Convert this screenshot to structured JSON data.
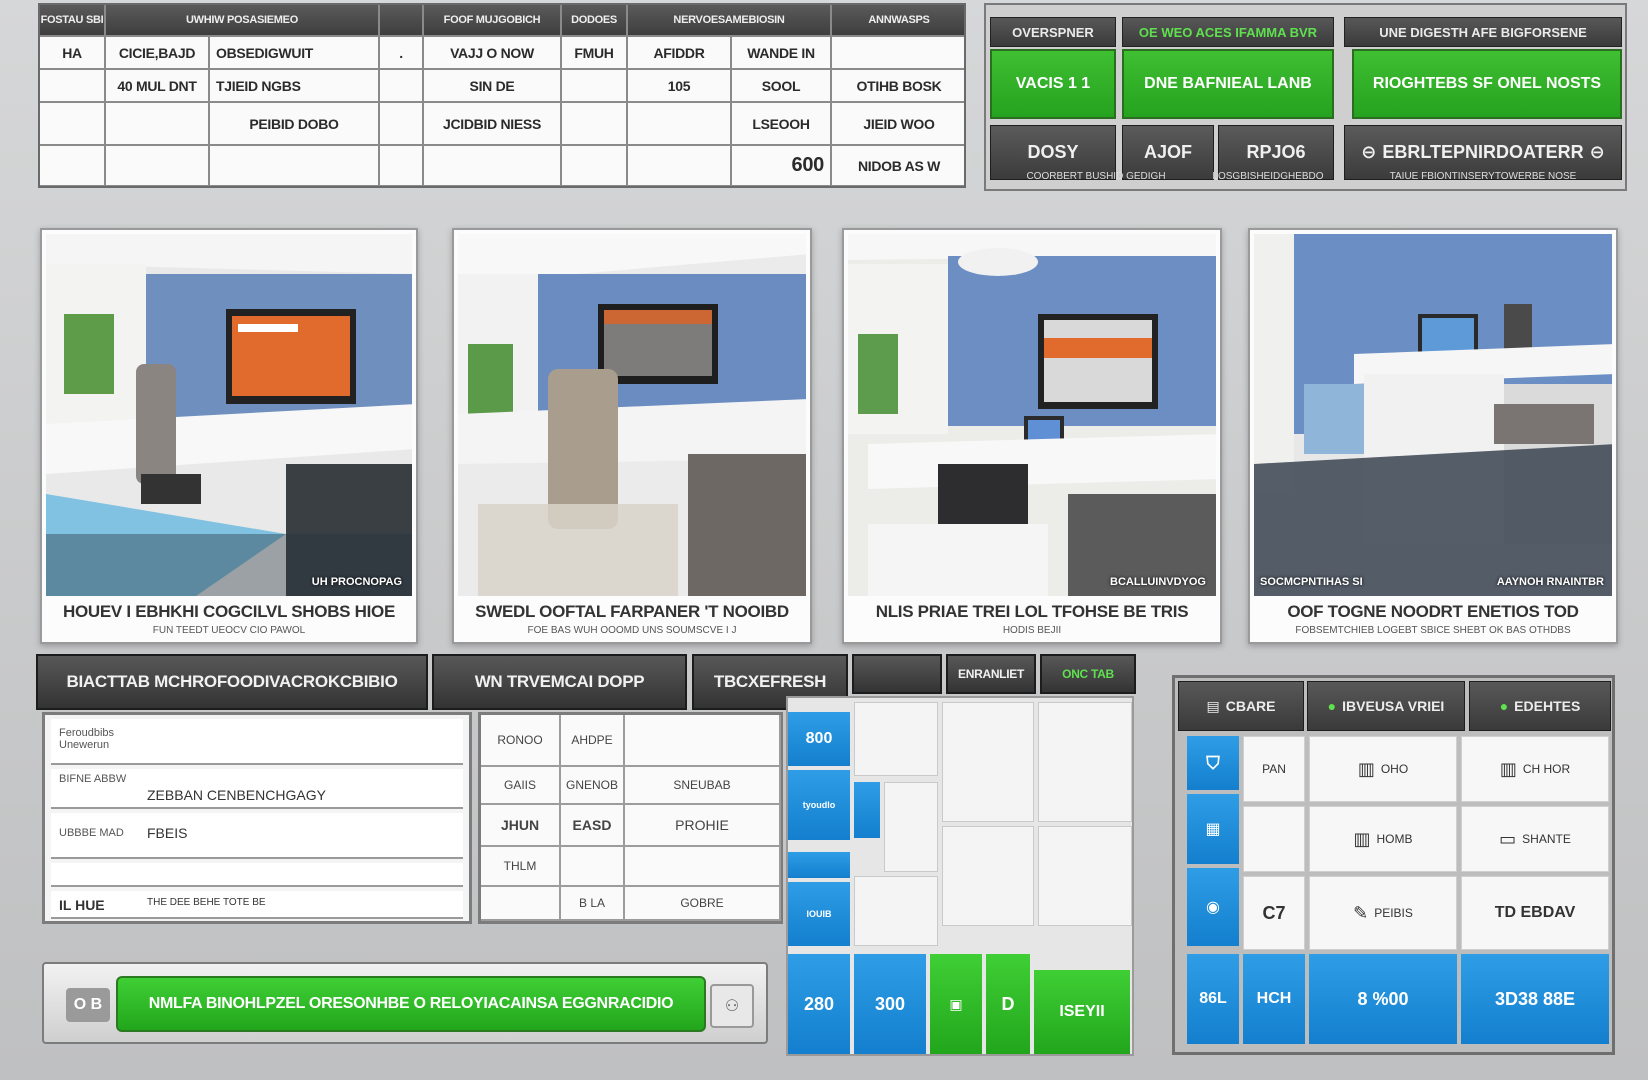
{
  "colors": {
    "accent_green": "#2db526",
    "accent_blue": "#1a8ad8",
    "header_dark": "#3e3e3e"
  },
  "top_table": {
    "headers": [
      "FOSTAU SBI",
      "UWHIW POSASIEMEO",
      "",
      "FOOF MUJGOBICH",
      "DODOES",
      "NERVOESAMEBIOSIN",
      "",
      "ANNWASPS"
    ],
    "rows": [
      [
        "HA",
        "CICIE,BAJD",
        "OBSEDIGWUIT",
        ".",
        "VAJJ O NOW",
        "FMUH",
        "AFIDDR",
        "WANDE IN",
        ""
      ],
      [
        "",
        "40 MUL DNT",
        "TJIEID NGBS",
        "",
        "SIN DE",
        "",
        "105",
        "SOOL",
        "OTIHB BOSK"
      ],
      [
        "",
        "",
        "PEIBID DOBO",
        "",
        "JCIDBID NIESS",
        "",
        "",
        "LSEOOH",
        "JIEID WOO"
      ],
      [
        "",
        "",
        "",
        "",
        "",
        "",
        "",
        "600",
        "NIDOB AS W"
      ]
    ]
  },
  "top_panel": {
    "headers": [
      "OVERSPNER",
      "OE WEO ACES IFAMMA BVR",
      "UNE DIGESTH AFE BIGFORSENE"
    ],
    "green_buttons": [
      "VACIS 1 1",
      "DNE BAFNIEAL LANB",
      "RIOGHTEBS SF ONEL NOSTS"
    ],
    "dark_buttons": [
      "DOSY",
      "AJOF",
      "RPJO6",
      "EBRLTEPNIRDOATERR"
    ],
    "footer": [
      "COORBERT BUSHID GEDIGH",
      "LOSGBISHEIDGHEBDO",
      "TAIUE FBIONTINSERYTOWERBE NOSE"
    ]
  },
  "cards": [
    {
      "title": "HOUEV I EBHKHI COGCILVL SHOBS HIOE",
      "subtitle": "FUN TEEDT            UEOCV  CIO PAWOL",
      "caption": "UH PROCNOPAG"
    },
    {
      "title": "SWEDL OOFTAL FARPANER 'T NOOIBD",
      "subtitle": "FOE BAS WUH              OOOMD          UNS SOUMSCVE  I J",
      "caption": ""
    },
    {
      "title": "NLIS PRIAE  TREI LOL TFOHSE BE TRIS",
      "subtitle": "HODIS BEJII",
      "caption": "BCALLUINVDYOG"
    },
    {
      "title": "OOF TOGNE NOODRT ENETIOS TOD",
      "subtitle": "FOBSEMTCHIEB LOGEBT SBICE SHEBT OK BAS OTHDBS",
      "caption_left": "SOCMCPNTIHAS SI",
      "caption_right": "AAYNOH RNAINTBR"
    }
  ],
  "tabs": [
    "BIACTTAB MCHROFOODIVACROKCBIBIO",
    "WN TRVEMCAI DOPP",
    "TBCXEFRESH",
    "",
    "ENRANLIET",
    "ONC TAB"
  ],
  "form": {
    "rows": [
      {
        "label": "Feroudbibs\nUnewerun",
        "value": ""
      },
      {
        "label": "BIFNE  ABBW",
        "value": "ZEBBAN CENBENCHGAGY"
      },
      {
        "label": "UBBBE  MAD",
        "value": "FBEIS"
      },
      {
        "label": "",
        "value": ""
      },
      {
        "label": "IL HUE",
        "value": "THE DEE BEHE TOTE BE"
      }
    ]
  },
  "mid_grid": [
    [
      "RONOO",
      "AHDPE",
      ""
    ],
    [
      "GAIIS",
      "GNENOB",
      "SNEUBAB"
    ],
    [
      "JHUN",
      "EASD",
      "PROHIE"
    ],
    [
      "THLM",
      "",
      ""
    ],
    [
      "",
      "B LA",
      "GOBRE"
    ]
  ],
  "action": {
    "left_label": "O B",
    "main_label": "NMLFA BINOHLPZEL ORESONHBE O RELOYIACAINSA EGGNRACIDIO",
    "right_icon": "people-icon"
  },
  "tiles": {
    "blue_top": "800",
    "blue_mid": "tyoudlo",
    "blue_low": "IOUIB",
    "bottom": [
      "280",
      "300",
      "",
      "D",
      "ISEYII"
    ]
  },
  "dash": {
    "headers": [
      "CBARE",
      "IBVEUSA VRIEI",
      "EDEHTES"
    ],
    "left_values": [
      "",
      "",
      "",
      "86L"
    ],
    "cells": [
      [
        "PAN",
        "OHO",
        "CH HOR"
      ],
      [
        "",
        "HOMB",
        "SHANTE"
      ],
      [
        "C7",
        "PEIBIS",
        "TD  EBDAV"
      ]
    ],
    "bottom": [
      "HCH",
      "8  %00",
      "3D38  88E"
    ]
  }
}
